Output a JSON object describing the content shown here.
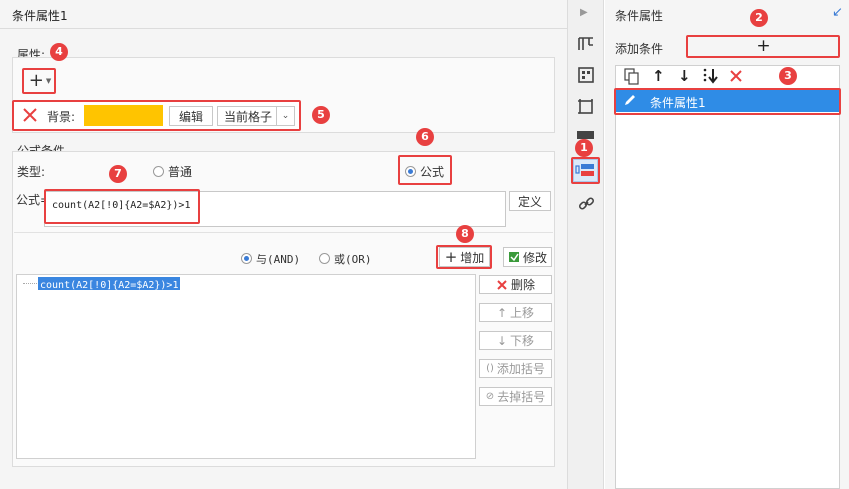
{
  "left": {
    "title": "条件属性1",
    "attr_label": "属性:",
    "background_label": "背景:",
    "background_color": "#FFC400",
    "edit_button": "编辑",
    "scope_value": "当前格子",
    "formula_section": "公式条件",
    "type_label": "类型:",
    "type_normal": "普通",
    "type_formula": "公式",
    "formula_label": "公式=",
    "formula_value": "count(A2[!0]{A2=$A2})>1",
    "define_button": "定义",
    "and_label": "与(AND)",
    "or_label": "或(OR)",
    "add_button": "增加",
    "modify_button": "修改",
    "condition_list": [
      "count(A2[!0]{A2=$A2})>1"
    ],
    "delete_button": "删除",
    "up_button": "上移",
    "down_button": "下移",
    "add_bracket_button": "添加括号",
    "remove_bracket_button": "去掉括号"
  },
  "right": {
    "title": "条件属性",
    "add_condition_label": "添加条件",
    "add_icon": "+",
    "conditions": [
      "条件属性1"
    ]
  },
  "badges": [
    "1",
    "2",
    "3",
    "4",
    "5",
    "6",
    "7",
    "8"
  ],
  "colors": {
    "accent": "#3a7bd5",
    "selected": "#2f8ce6",
    "annotation": "#e84040"
  }
}
